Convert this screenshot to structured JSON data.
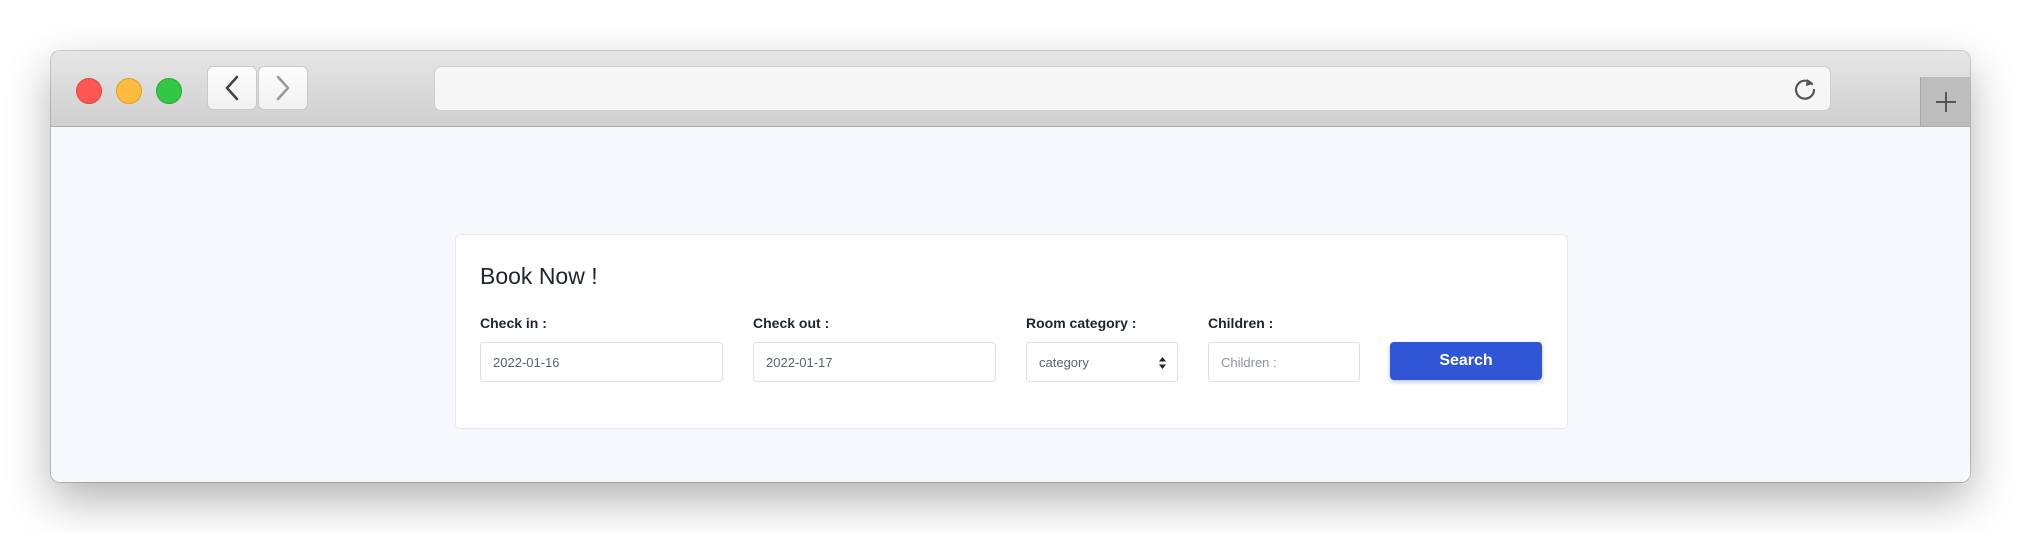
{
  "browser": {
    "url": "",
    "new_tab_label": "+"
  },
  "booking": {
    "title": "Book Now !",
    "check_in": {
      "label": "Check in :",
      "value": "2022-01-16"
    },
    "check_out": {
      "label": "Check out :",
      "value": "2022-01-17"
    },
    "room_category": {
      "label": "Room category :",
      "selected": "category"
    },
    "children": {
      "label": "Children :",
      "placeholder": "Children :"
    },
    "search_label": "Search"
  },
  "colors": {
    "accent": "#3055d6",
    "page_background": "#f7f8fb"
  }
}
